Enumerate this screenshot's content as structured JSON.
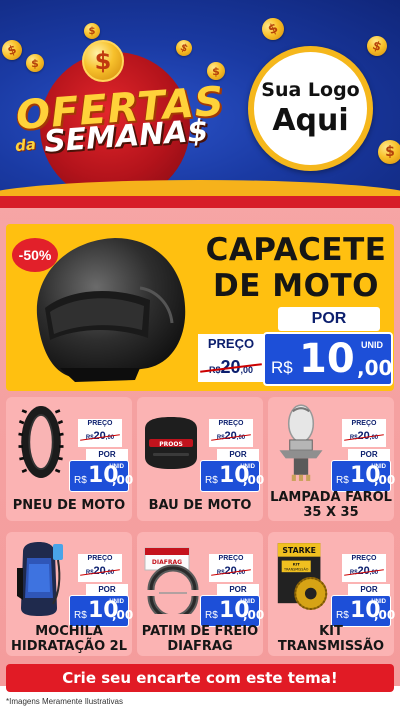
{
  "header": {
    "title_top": "OFERTAS",
    "title_da": "da",
    "title_bottom": "SEMANA$",
    "logo_line1": "Sua Logo",
    "logo_line2": "Aqui",
    "coin_symbol": "$"
  },
  "featured": {
    "discount": "-50%",
    "name_line1": "CAPACETE",
    "name_line2": "DE MOTO",
    "preco_label": "PREÇO",
    "old_currency": "R$",
    "old_int": "20",
    "old_dec": ",00",
    "por_label": "POR",
    "currency": "R$",
    "price_int": "10",
    "price_dec": ",00",
    "unit": "UNID"
  },
  "products": [
    {
      "name_line1": "PNEU DE MOTO",
      "name_line2": "",
      "preco_label": "PREÇO",
      "old_currency": "R$",
      "old_int": "20",
      "old_dec": ",00",
      "por_label": "POR",
      "currency": "R$",
      "price_int": "10",
      "price_dec": ",00",
      "unit": "UNID"
    },
    {
      "name_line1": "BAU DE MOTO",
      "name_line2": "",
      "preco_label": "PREÇO",
      "old_currency": "R$",
      "old_int": "20",
      "old_dec": ",00",
      "por_label": "POR",
      "currency": "R$",
      "price_int": "10",
      "price_dec": ",00",
      "unit": "UNID"
    },
    {
      "name_line1": "LAMPADA FAROL",
      "name_line2": "35 X 35",
      "preco_label": "PREÇO",
      "old_currency": "R$",
      "old_int": "20",
      "old_dec": ",00",
      "por_label": "POR",
      "currency": "R$",
      "price_int": "10",
      "price_dec": ",00",
      "unit": "UNID"
    },
    {
      "name_line1": "MOCHILA",
      "name_line2": "HIDRATAÇÃO 2L",
      "preco_label": "PREÇO",
      "old_currency": "R$",
      "old_int": "20",
      "old_dec": ",00",
      "por_label": "POR",
      "currency": "R$",
      "price_int": "10",
      "price_dec": ",00",
      "unit": "UNID"
    },
    {
      "name_line1": "PATIM DE FREIO",
      "name_line2": "DIAFRAG",
      "preco_label": "PREÇO",
      "old_currency": "R$",
      "old_int": "20",
      "old_dec": ",00",
      "por_label": "POR",
      "currency": "R$",
      "price_int": "10",
      "price_dec": ",00",
      "unit": "UNID"
    },
    {
      "name_line1": "KIT",
      "name_line2": "TRANSMISSÃO",
      "preco_label": "PREÇO",
      "old_currency": "R$",
      "old_int": "20",
      "old_dec": ",00",
      "por_label": "POR",
      "currency": "R$",
      "price_int": "10",
      "price_dec": ",00",
      "unit": "UNID"
    }
  ],
  "product_image_labels": {
    "bau_brand": "PROOS",
    "patim_brand": "DIAFRAG",
    "kit_brand": "STARKE",
    "kit_box_line1": "KIT",
    "kit_box_line2": "TRANSMISSÃO"
  },
  "cta": "Crie seu encarte com este tema!",
  "footer_note": "*Imagens Meramente Ilustrativas",
  "colors": {
    "header_blue": "#1a3aa3",
    "accent_red": "#e11b25",
    "accent_yellow": "#ffc010",
    "price_blue": "#1d4fd8",
    "body_pink": "#f6a5a5"
  },
  "icons": [
    "dollar-coin-icon",
    "helmet-image",
    "tire-image",
    "top-case-image",
    "headlight-bulb-image",
    "hydration-backpack-image",
    "brake-shoe-image",
    "transmission-kit-image"
  ]
}
